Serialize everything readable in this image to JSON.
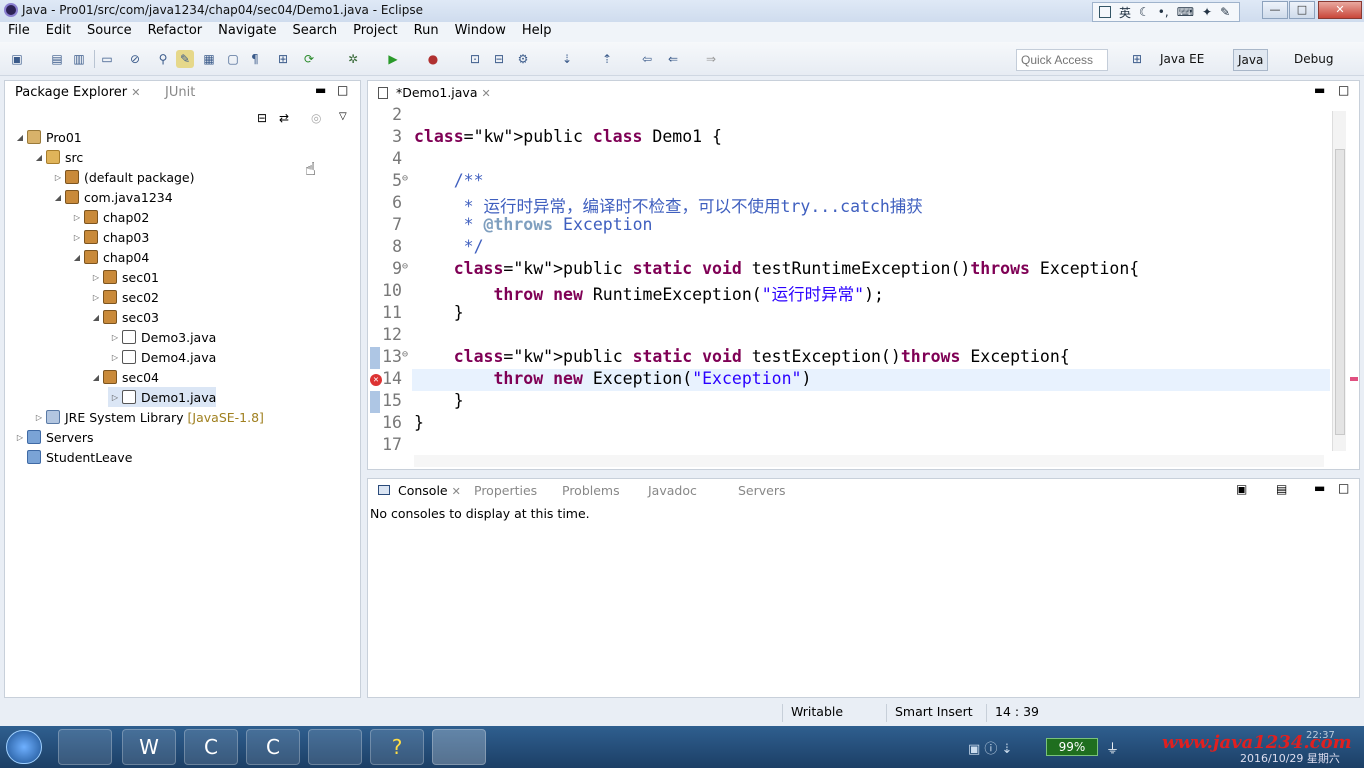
{
  "window": {
    "title": "Java - Pro01/src/com/java1234/chap04/sec04/Demo1.java - Eclipse",
    "ime_label": "英",
    "min_label": "—",
    "max_label": "□",
    "close_label": "✕"
  },
  "menu": [
    "File",
    "Edit",
    "Source",
    "Refactor",
    "Navigate",
    "Search",
    "Project",
    "Run",
    "Window",
    "Help"
  ],
  "toolbar": {
    "quick_access_placeholder": "Quick Access",
    "perspectives": [
      "Java EE",
      "Java",
      "Debug"
    ]
  },
  "package_explorer": {
    "tab_label": "Package Explorer",
    "junit_tab": "JUnit",
    "tree": [
      {
        "label": "Pro01",
        "depth": 0,
        "icon": "project-icon",
        "expanded": true
      },
      {
        "label": "src",
        "depth": 1,
        "icon": "source-folder-icon",
        "expanded": true
      },
      {
        "label": "(default package)",
        "depth": 2,
        "icon": "package-icon",
        "expanded": false
      },
      {
        "label": "com.java1234",
        "depth": 2,
        "icon": "package-icon",
        "expanded": true
      },
      {
        "label": "chap02",
        "depth": 3,
        "icon": "package-icon",
        "expanded": false
      },
      {
        "label": "chap03",
        "depth": 3,
        "icon": "package-icon",
        "expanded": false
      },
      {
        "label": "chap04",
        "depth": 3,
        "icon": "package-icon",
        "expanded": true
      },
      {
        "label": "sec01",
        "depth": 4,
        "icon": "package-icon",
        "expanded": false
      },
      {
        "label": "sec02",
        "depth": 4,
        "icon": "package-icon",
        "expanded": false
      },
      {
        "label": "sec03",
        "depth": 4,
        "icon": "package-icon",
        "expanded": true
      },
      {
        "label": "Demo3.java",
        "depth": 5,
        "icon": "java-file-icon",
        "expanded": false
      },
      {
        "label": "Demo4.java",
        "depth": 5,
        "icon": "java-file-icon",
        "expanded": false
      },
      {
        "label": "sec04",
        "depth": 4,
        "icon": "package-icon",
        "expanded": true
      },
      {
        "label": "Demo1.java",
        "depth": 5,
        "icon": "java-file-icon",
        "expanded": false,
        "selected": true
      },
      {
        "label": "JRE System Library",
        "suffix": "[JavaSE-1.8]",
        "depth": 1,
        "icon": "library-icon",
        "expanded": false
      },
      {
        "label": "Servers",
        "depth": 0,
        "icon": "folder-icon",
        "expanded": false
      },
      {
        "label": "StudentLeave",
        "depth": 0,
        "icon": "folder-icon",
        "expanded": null
      }
    ]
  },
  "editor": {
    "tab_label": "*Demo1.java",
    "lines": [
      {
        "num": "2",
        "text": ""
      },
      {
        "num": "3",
        "text": "public class Demo1 {"
      },
      {
        "num": "4",
        "text": ""
      },
      {
        "num": "5",
        "text": "    /**"
      },
      {
        "num": "6",
        "text": "     * 运行时异常，编译时不检查，可以不使用try...catch捕获"
      },
      {
        "num": "7",
        "text": "     * @throws Exception"
      },
      {
        "num": "8",
        "text": "     */"
      },
      {
        "num": "9",
        "text": "    public static void testRuntimeException()throws Exception{"
      },
      {
        "num": "10",
        "text": "        throw new RuntimeException(\"运行时异常\");"
      },
      {
        "num": "11",
        "text": "    }"
      },
      {
        "num": "12",
        "text": ""
      },
      {
        "num": "13",
        "text": "    public static void testException()throws Exception{"
      },
      {
        "num": "14",
        "text": "        throw new Exception(\"Exception\")"
      },
      {
        "num": "15",
        "text": "    }"
      },
      {
        "num": "16",
        "text": "}"
      },
      {
        "num": "17",
        "text": ""
      }
    ],
    "error_line": "14"
  },
  "console": {
    "tabs": [
      "Console",
      "Properties",
      "Problems",
      "Javadoc",
      "Servers"
    ],
    "message": "No consoles to display at this time."
  },
  "status": {
    "writable": "Writable",
    "insert_mode": "Smart Insert",
    "position": "14 : 39"
  },
  "taskbar": {
    "battery": "99%",
    "watermark": "www.java1234.com",
    "date": "2016/10/29 星期六",
    "time": "22:37"
  }
}
